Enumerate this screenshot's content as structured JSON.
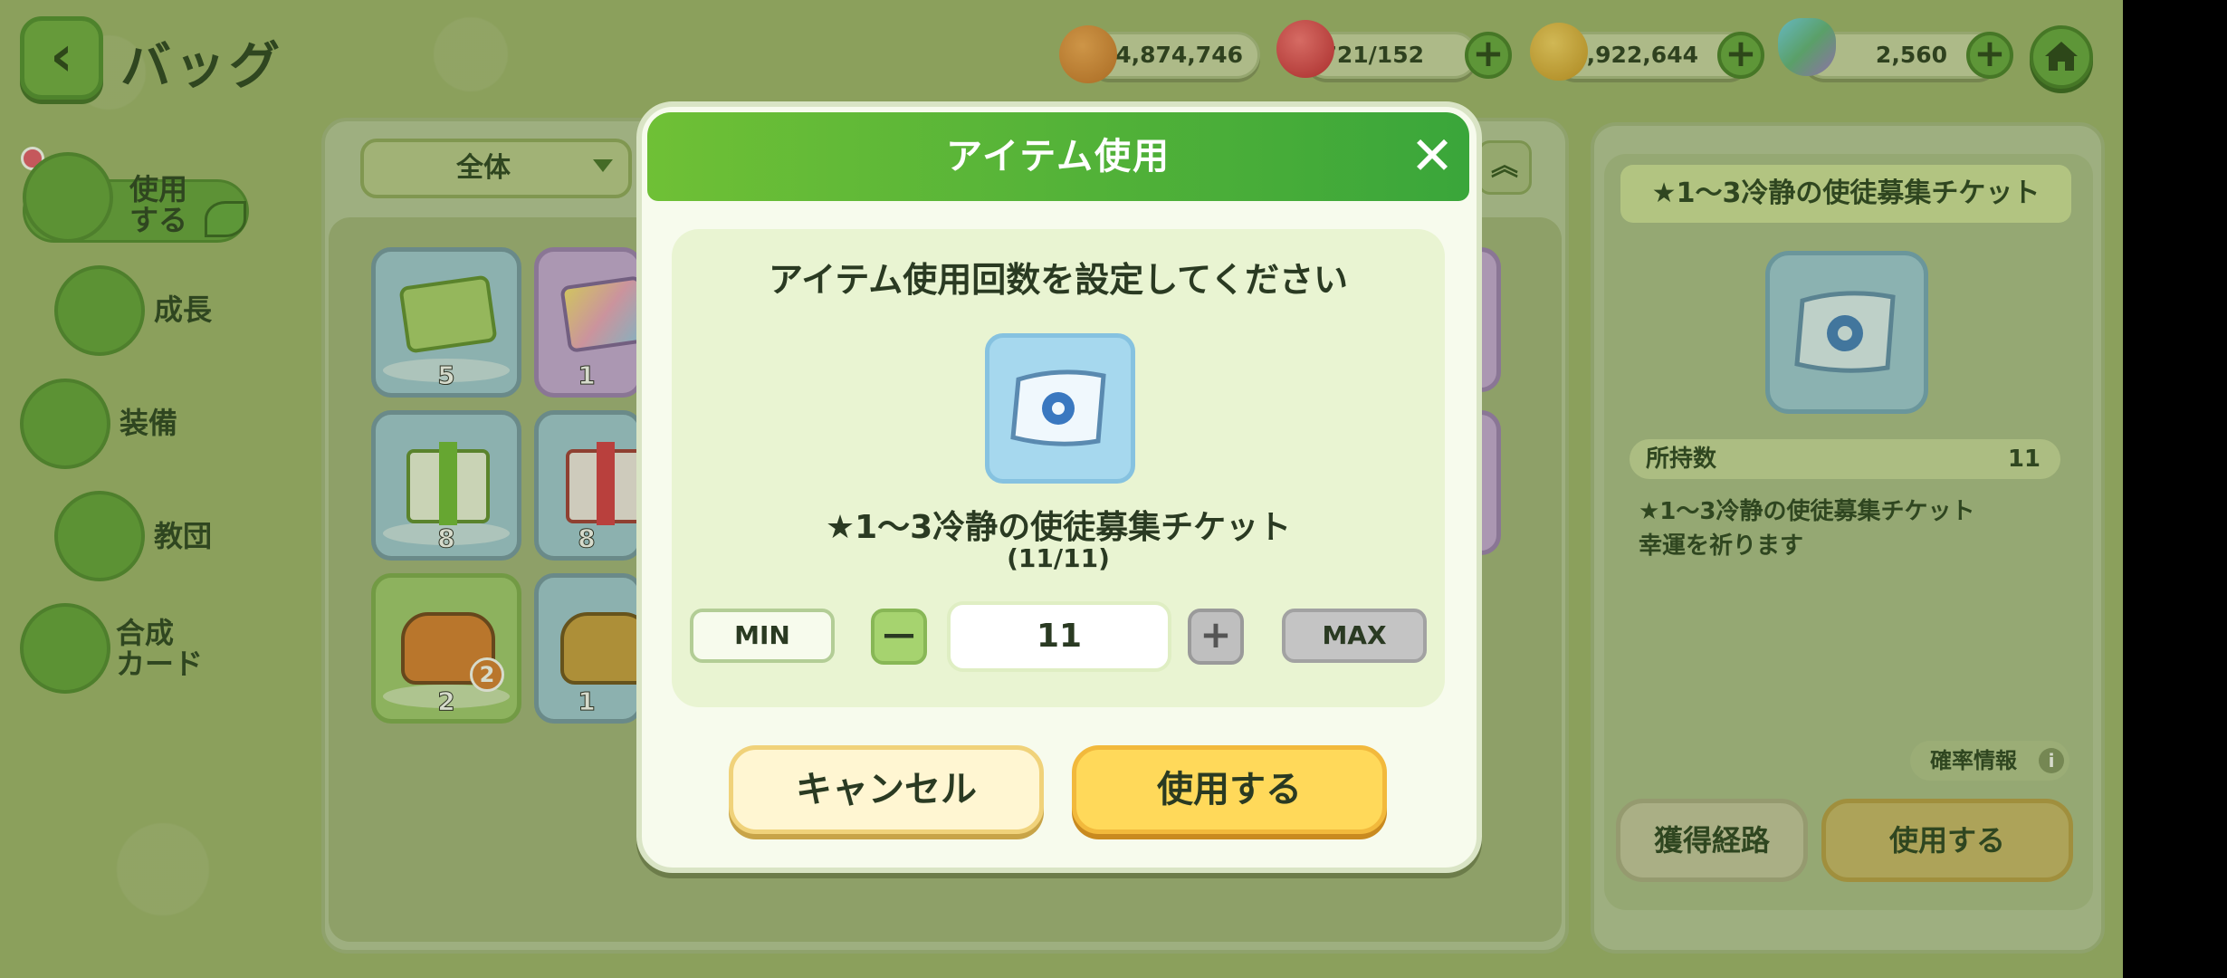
{
  "header": {
    "back_icon": "chevron-left-icon",
    "title": "バッグ"
  },
  "currencies": [
    {
      "icon": "macaron-icon",
      "color": "#d07a2a",
      "value": "4,874,746",
      "has_plus": false
    },
    {
      "icon": "jelly-icon",
      "color": "#d8283c",
      "value": "721/152",
      "has_plus": true
    },
    {
      "icon": "gold-coin-icon",
      "color": "#e0a82a",
      "value": "1,922,644",
      "has_plus": true
    },
    {
      "icon": "crystal-icon",
      "color": "#5ab0d8",
      "value": "2,560",
      "has_plus": true
    }
  ],
  "sidebar": {
    "items": [
      {
        "label": "使用\nする",
        "icon": "chest-icon",
        "active": true
      },
      {
        "label": "成長",
        "icon": "growth-icon",
        "active": false
      },
      {
        "label": "装備",
        "icon": "equipment-icon",
        "active": false
      },
      {
        "label": "教団",
        "icon": "temple-icon",
        "active": false
      },
      {
        "label": "合成\nカード",
        "icon": "card-icon",
        "active": false
      }
    ]
  },
  "inventory": {
    "filter_label": "全体",
    "items": [
      {
        "count": "5",
        "bg": "#9cc7d8",
        "icon": "green-ticket-icon"
      },
      {
        "count": "1",
        "bg": "#c6a4dc",
        "icon": "rainbow-ticket-icon"
      },
      {
        "count": "8",
        "bg": "#9cc7d8",
        "icon": "green-gift-icon"
      },
      {
        "count": "8",
        "bg": "#9cc7d8",
        "icon": "red-gift-icon"
      },
      {
        "count": "2",
        "bg": "#9ec86c",
        "icon": "orange-bag-icon"
      },
      {
        "count": "1",
        "bg": "#9cc7d8",
        "icon": "brown-bag-icon"
      }
    ]
  },
  "detail": {
    "title": "★1～3冷静の使徒募集チケット",
    "owned_label": "所持数",
    "owned_value": "11",
    "desc_line1": "★1～3冷静の使徒募集チケット",
    "desc_line2": "幸運を祈ります",
    "prob_label": "確率情報",
    "route_label": "獲得経路",
    "use_label": "使用する"
  },
  "dialog": {
    "title": "アイテム使用",
    "prompt": "アイテム使用回数を設定してください",
    "item_name": "★1～3冷静の使徒募集チケット",
    "item_fraction": "(11/11)",
    "min_label": "MIN",
    "max_label": "MAX",
    "quantity": "11",
    "cancel_label": "キャンセル",
    "use_label": "使用する"
  }
}
